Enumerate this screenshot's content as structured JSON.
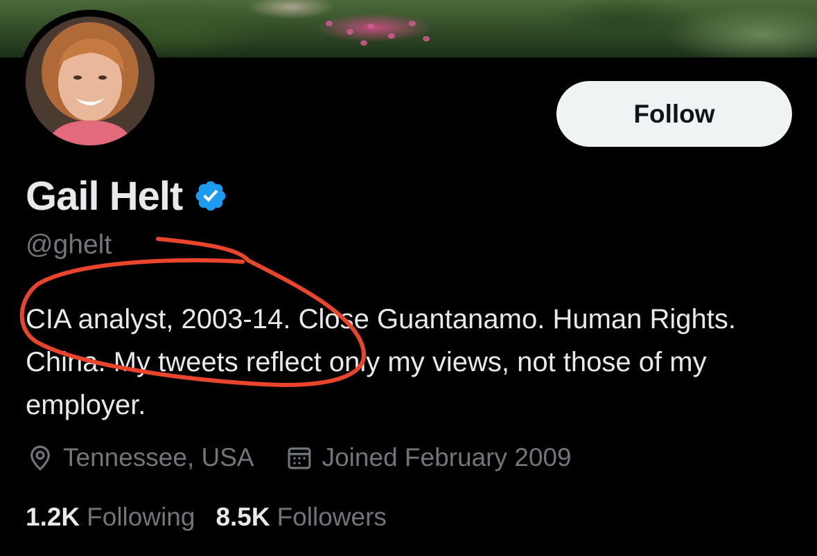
{
  "profile": {
    "display_name": "Gail Helt",
    "handle": "@ghelt",
    "bio": "CIA analyst, 2003-14. Close Guantanamo. Human Rights. China. My tweets reflect only my views, not those of my employer.",
    "location": "Tennessee, USA",
    "joined": "Joined February 2009"
  },
  "actions": {
    "follow_label": "Follow"
  },
  "stats": {
    "following_count": "1.2K",
    "following_label": "Following",
    "followers_count": "8.5K",
    "followers_label": "Followers"
  },
  "colors": {
    "background": "#000000",
    "primary_text": "#e7e9ea",
    "secondary_text": "#71767b",
    "verified": "#1d9bf0",
    "follow_button_bg": "#eff3f4",
    "annotation": "#e8452c"
  },
  "icons": [
    "verified-badge-icon",
    "location-pin-icon",
    "calendar-icon"
  ]
}
